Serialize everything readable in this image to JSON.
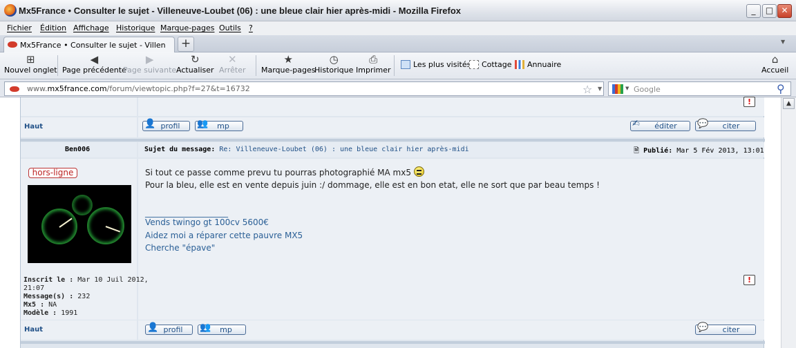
{
  "window": {
    "title": "Mx5France • Consulter le sujet - Villeneuve-Loubet (06) : une bleue clair hier après-midi - Mozilla Firefox",
    "minimize": "_",
    "maximize": "□",
    "close": "✕"
  },
  "menu": [
    "Fichier",
    "Édition",
    "Affichage",
    "Historique",
    "Marque-pages",
    "Outils",
    "?"
  ],
  "tab": {
    "label": "Mx5France • Consulter le sujet - Villeneuve-...",
    "close": "×",
    "new_tab": "+"
  },
  "toolbar": {
    "new_tab": "Nouvel onglet",
    "back": "Page précédente",
    "forward": "Page suivante",
    "reload": "Actualiser",
    "stop": "Arrêter",
    "bookmarks": "Marque-pages",
    "history": "Historique",
    "print": "Imprimer",
    "home": "Accueil"
  },
  "bookmarks_bar": [
    "Les plus visités",
    "Cottage",
    "Annuaire"
  ],
  "urlbar": {
    "prefix": "www.",
    "domain": "mx5france.com",
    "path": "/forum/viewtopic.php?f=27&t=16732"
  },
  "search": {
    "placeholder": "Google"
  },
  "forum": {
    "haut": "Haut",
    "profil": "profil",
    "mp": "mp",
    "editer": "éditer",
    "citer": "citer",
    "report": "!",
    "post": {
      "author": "Ben006",
      "subject_label": "Sujet du message:",
      "subject": "Re: Villeneuve-Loubet (06) : une bleue clair hier après-midi",
      "posted_label": "Publié:",
      "posted_date": "Mar 5 Fév 2013, 13:01",
      "status": "hors-ligne",
      "body_line1": "Si tout ce passe comme prevu tu pourras photographié MA mx5",
      "body_line2": "Pour la bleu, elle est en vente depuis juin :/ dommage, elle est en bon etat, elle ne sort que par beau temps !",
      "signature_rule": "____________________",
      "signature": [
        "Vends twingo gt 100cv 5600€",
        "Aidez moi a réparer cette pauvre MX5",
        "Cherche \"épave\""
      ],
      "profile": {
        "inscrit_label": "Inscrit le :",
        "inscrit_value": "Mar 10 Juil 2012,",
        "inscrit_time": "21:07",
        "messages_label": "Message(s) :",
        "messages_value": "232",
        "mx5_label": "Mx5 :",
        "mx5_value": "NA",
        "modele_label": "Modèle :",
        "modele_value": "1991"
      }
    }
  }
}
